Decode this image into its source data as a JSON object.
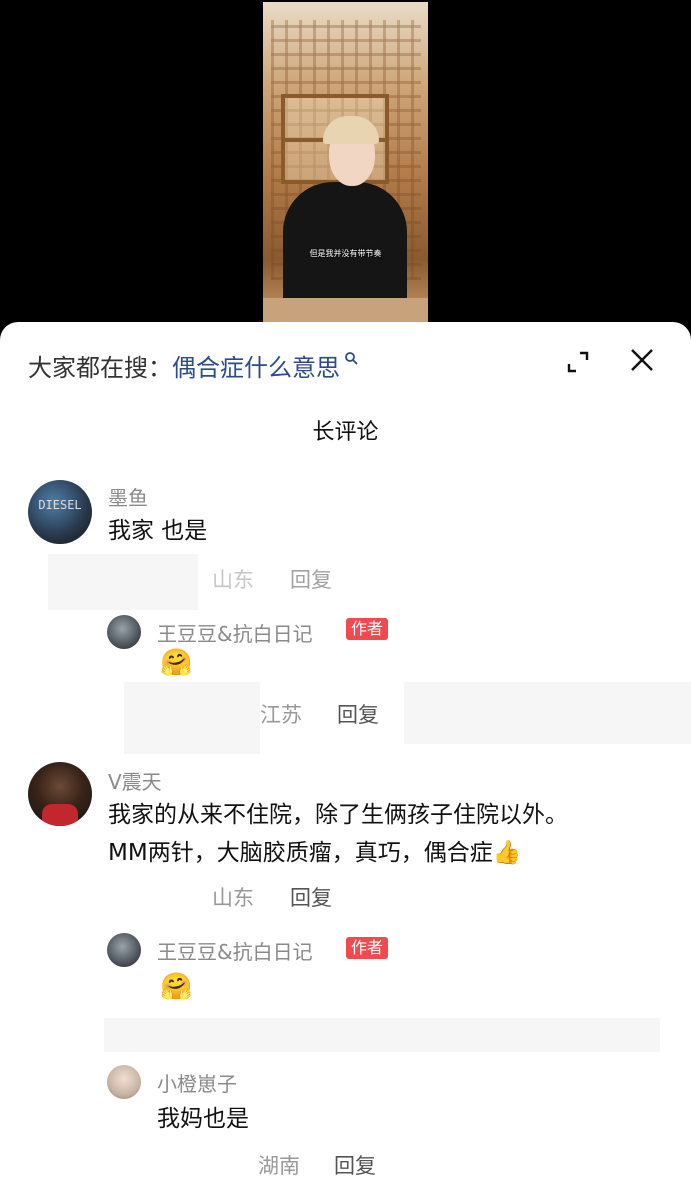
{
  "video": {
    "subtitle": "但是我并没有带节奏"
  },
  "search": {
    "prefix": "大家都在搜：",
    "term": "偶合症什么意思"
  },
  "header": {
    "title": "⁠长评论"
  },
  "comments": [
    {
      "name": "墨鱼",
      "text": "我家 也是",
      "location": "山东",
      "reply_label": "回复",
      "reply": {
        "name": "王豆豆&抗白日记",
        "badge": "作者",
        "emoji": "🤗",
        "location": "江苏",
        "reply_label": "回复"
      }
    },
    {
      "name": "V震天",
      "text_lines": [
        "我家的从来不住院，除了生俩孩子住院以外。",
        "MM两针，大脑胶质瘤，真巧，偶合症👍"
      ],
      "location": "山东",
      "reply_label": "回复",
      "reply": {
        "name": "王豆豆&抗白日记",
        "badge": "作者",
        "emoji": "🤗"
      }
    },
    {
      "name": "小橙崽子",
      "text": "我妈也是",
      "location": "湖南",
      "reply_label": "回复"
    }
  ],
  "colors": {
    "accent": "#2c4b8a",
    "badge": "#f04a4f"
  }
}
